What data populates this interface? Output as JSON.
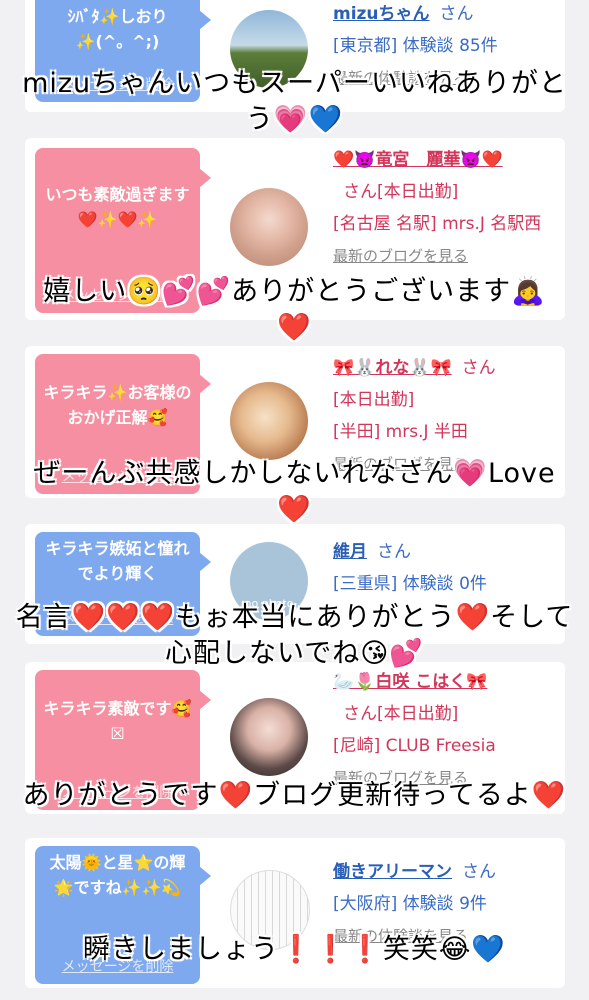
{
  "cards": [
    {
      "bubble_text": "ｼﾊﾞﾀ✨しおり✨(^。^;)",
      "delete_label": "メッセージを削除",
      "name": "mizuちゃん",
      "san": "さん",
      "meta": [
        "[東京都] 体験談 85件"
      ],
      "latest_label": "最新の体験談を見る",
      "caption": "mizuちゃんいつもスーパーいいねありがとう💗💙"
    },
    {
      "bubble_text": "いつも素敵過ぎます❤️✨❤️✨",
      "delete_label": "メッセージを削除",
      "name": "❤️👿竜宮　麗華👿❤️",
      "san": "さん[本日出勤]",
      "meta": [
        "[名古屋 名駅] mrs.J 名駅西"
      ],
      "latest_label": "最新のブログを見る",
      "caption": "嬉しい🥺💕💕ありがとうございます🙇‍♀️❤️"
    },
    {
      "bubble_text": "キラキラ✨お客様のおかげ正解🥰",
      "delete_label": "メッセージを削除",
      "name": "🎀🐰れな🐰🎀",
      "san": "さん",
      "meta": [
        "[本日出勤]",
        "[半田] mrs.J 半田"
      ],
      "latest_label": "最新のブログを見る",
      "caption": "ぜーんぶ共感しかしないれなさん💗Love❤️"
    },
    {
      "bubble_text": "キラキラ嫉妬と憧れでより輝く",
      "delete_label": "メッセージを削除",
      "name": "維月",
      "san": "さん",
      "meta": [
        "[三重県] 体験談 0件"
      ],
      "latest_label": "",
      "avatar_text": "no photo",
      "caption": "名言❤️❤️❤️もぉ本当にありがとう❤️そして心配しないでね😘💕"
    },
    {
      "bubble_text": "キラキラ素敵です🥰☒",
      "delete_label": "メッセージを削除",
      "name": "🦢🌷白咲 こはく🎀",
      "san": "さん[本日出勤]",
      "meta": [
        "[尼崎] CLUB Freesia"
      ],
      "latest_label": "最新のブログを見る",
      "caption": "ありがとうです❤️ブログ更新待ってるよ❤️"
    },
    {
      "bubble_text": "太陽🌞と星⭐️の輝🌟ですね✨✨💫",
      "delete_label": "メッセージを削除",
      "name": "働きアリーマン",
      "san": "さん",
      "meta": [
        "[大阪府] 体験談 9件"
      ],
      "latest_label": "最新の体験談を見る",
      "caption": "瞬きしましょう❗️❗️❗️笑笑😂💙"
    }
  ],
  "colors": {
    "pink_bubble": "#f58fa1",
    "blue_bubble": "#7fa9ee",
    "pink_text": "#d2365b",
    "blue_text": "#3b6bc5",
    "page_bg": "#f1f1f3"
  }
}
